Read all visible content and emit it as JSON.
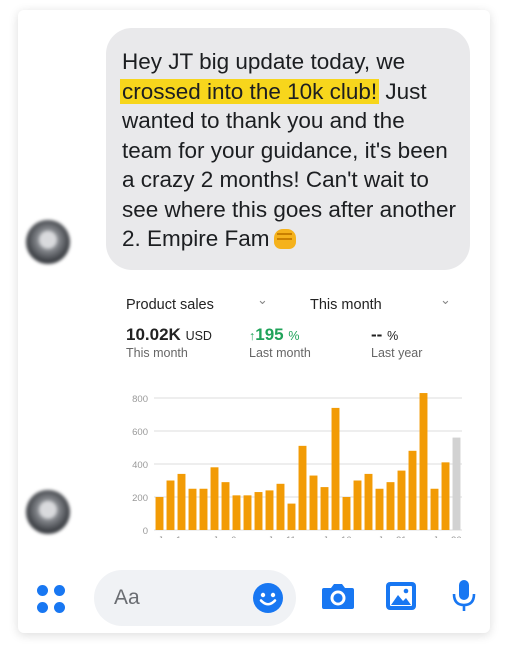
{
  "message": {
    "text_before": "Hey JT big update today, we ",
    "highlight": "crossed into the 10k club!",
    "text_after": " Just wanted to thank you and the team for your guidance, it's been a crazy 2 months! Can't wait to see where this goes after another 2. Empire Fam",
    "emoji_icon": "fist-emoji"
  },
  "analytics": {
    "metric_select": "Product sales",
    "period_select": "This month",
    "kpis": [
      {
        "value": "10.02K",
        "unit": "USD",
        "label": "This month"
      },
      {
        "arrow": "↑",
        "value": "195",
        "unit": "%",
        "label": "Last month"
      },
      {
        "value": "--",
        "unit": "%",
        "label": "Last year"
      }
    ]
  },
  "chart_data": {
    "type": "bar",
    "y_ticks": [
      0,
      200,
      400,
      600,
      800
    ],
    "ylim": [
      0,
      860
    ],
    "grid": true,
    "x_tick_labels": [
      "Jan 1",
      "Jan 6",
      "Jan 11",
      "Jan 16",
      "Jan 21",
      "Jan 26",
      "Jan 31"
    ],
    "values": [
      200,
      300,
      340,
      250,
      250,
      380,
      290,
      210,
      210,
      230,
      240,
      280,
      160,
      510,
      330,
      260,
      740,
      200,
      300,
      340,
      250,
      290,
      360,
      480,
      830,
      250,
      410
    ],
    "projected_value": 560,
    "colors": {
      "bar": "#f29b05",
      "projected": "#d2d2d2",
      "grid": "#dddddd",
      "axis_text": "#999999"
    }
  },
  "composer": {
    "placeholder": "Aa",
    "icons": [
      "apps-icon",
      "smile-icon",
      "camera-icon",
      "photo-icon",
      "microphone-icon"
    ],
    "accent": "#1877f2"
  }
}
